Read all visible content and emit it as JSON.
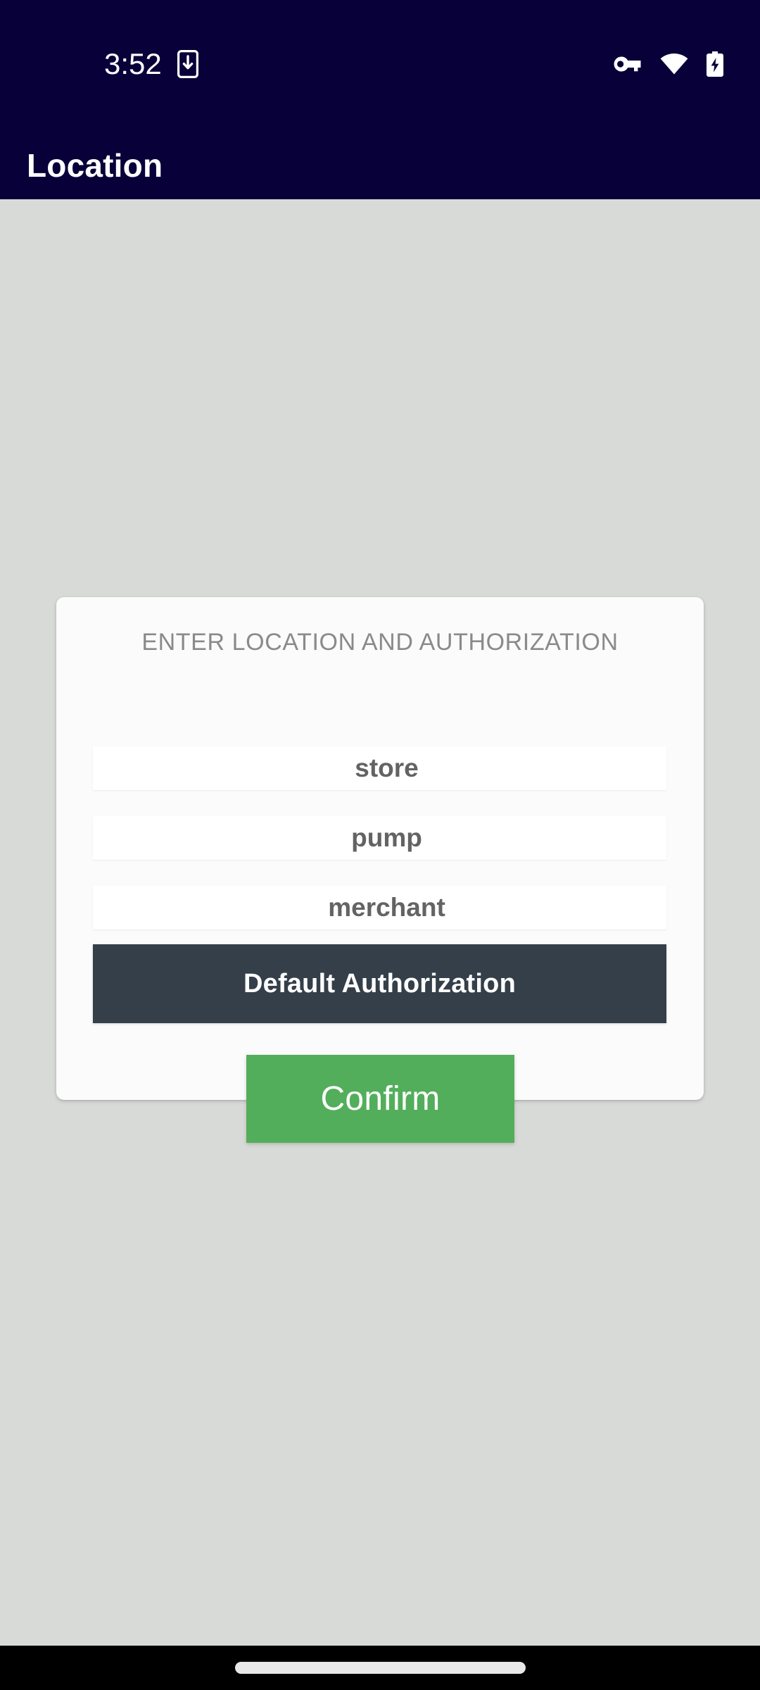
{
  "status_bar": {
    "time": "3:52",
    "left_icons": [
      {
        "name": "phone-download-icon",
        "label": "phone-download"
      }
    ],
    "right_icons": [
      {
        "name": "vpn-key-icon",
        "label": "vpn-key"
      },
      {
        "name": "wifi-icon",
        "label": "wifi"
      },
      {
        "name": "battery-charging-icon",
        "label": "battery-charging"
      }
    ],
    "background_color": "#070039",
    "foreground_color": "#FFFFFF"
  },
  "app_bar": {
    "title": "Location",
    "background_color": "#070039",
    "title_color": "#FFFFFF"
  },
  "content": {
    "background_color": "#D8DAD8"
  },
  "card": {
    "heading": "ENTER LOCATION AND AUTHORIZATION",
    "heading_color": "#8A8A8A",
    "background_color": "#FBFBFB",
    "fields": [
      {
        "name": "store",
        "placeholder": "store",
        "value": ""
      },
      {
        "name": "pump",
        "placeholder": "pump",
        "value": ""
      },
      {
        "name": "merchant",
        "placeholder": "merchant",
        "value": ""
      }
    ],
    "default_auth_label": "Default Authorization",
    "default_auth_color": "#343F49"
  },
  "actions": {
    "confirm_label": "Confirm",
    "confirm_color": "#53AE5B"
  },
  "nav_bar": {
    "background_color": "#000000",
    "pill_color": "#E8E8E8"
  }
}
